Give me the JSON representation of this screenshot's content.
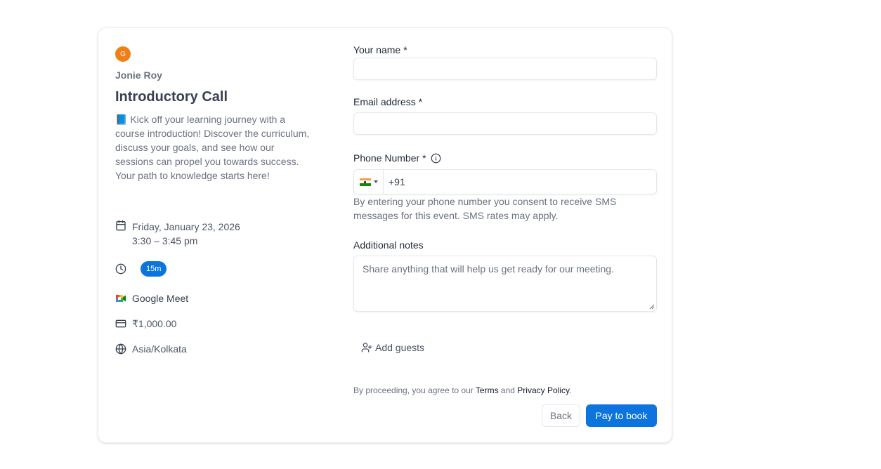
{
  "event": {
    "host_initial": "G",
    "host_name": "Jonie Roy",
    "title": "Introductory Call",
    "description": "📘 Kick off your learning journey with a course introduction! Discover the curriculum, discuss your goals, and see how our sessions can propel you towards success. Your path to knowledge starts here!",
    "date": "Friday, January 23, 2026",
    "time": "3:30 – 3:45 pm",
    "duration": "15m",
    "location": "Google Meet",
    "price": "₹1,000.00",
    "timezone": "Asia/Kolkata"
  },
  "form": {
    "name_label": "Your name",
    "email_label": "Email address",
    "phone_label": "Phone Number",
    "required_mark": "*",
    "phone_value": "+91",
    "phone_helper": "By entering your phone number you consent to receive SMS messages for this event. SMS rates may apply.",
    "notes_label": "Additional notes",
    "notes_placeholder": "Share anything that will help us get ready for our meeting.",
    "add_guests": "Add guests",
    "legal_prefix": "By proceeding, you agree to our",
    "terms": "Terms",
    "and": "and",
    "privacy": "Privacy Policy",
    "period": "."
  },
  "buttons": {
    "back": "Back",
    "pay": "Pay to book"
  },
  "colors": {
    "brand": "#0b74de",
    "avatar": "#f07f1a"
  },
  "icons": {
    "date": "calendar-icon",
    "duration": "clock-icon",
    "location": "google-meet-icon",
    "price": "credit-card-icon",
    "timezone": "globe-icon",
    "phone_info": "info-icon",
    "add_guests": "user-plus-icon"
  }
}
